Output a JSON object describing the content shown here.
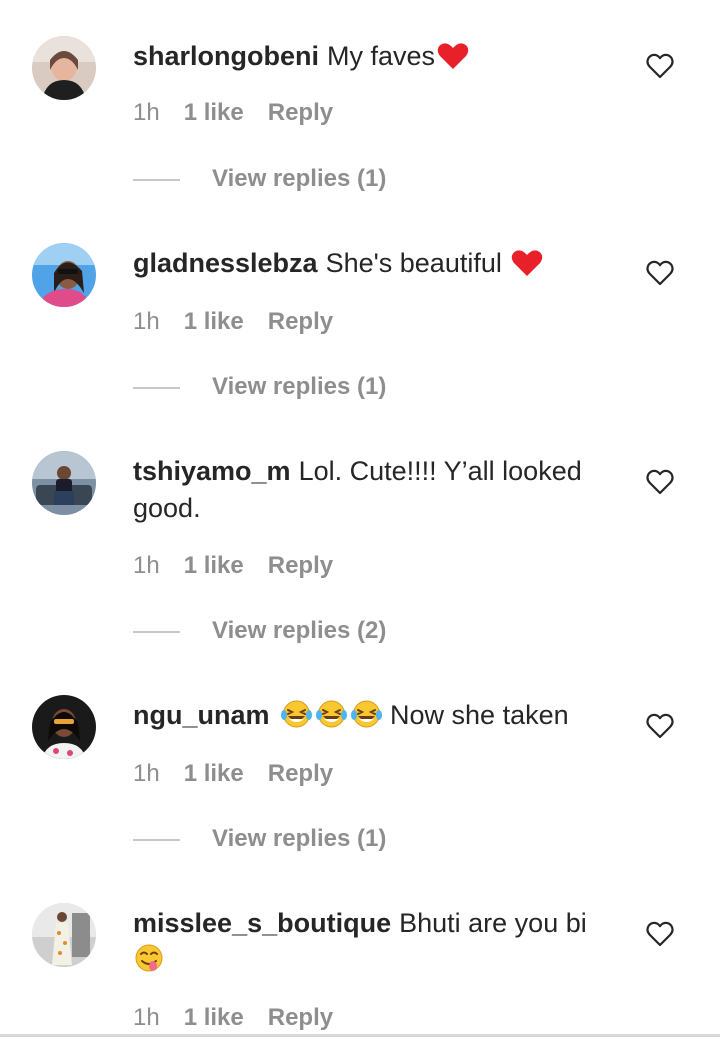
{
  "comments": [
    {
      "username": "sharlongobeni",
      "text": "My faves",
      "emoji": [
        "heart"
      ],
      "time": "1h",
      "likes": "1 like",
      "reply": "Reply",
      "view_replies": "View replies (1)"
    },
    {
      "username": "gladnesslebza",
      "text": "She's beautiful ",
      "emoji": [
        "heart"
      ],
      "time": "1h",
      "likes": "1 like",
      "reply": "Reply",
      "view_replies": "View replies (1)"
    },
    {
      "username": "tshiyamo_m",
      "text": "Lol. Cute!!!! Y’all looked good.",
      "emoji": [],
      "time": "1h",
      "likes": "1 like",
      "reply": "Reply",
      "view_replies": "View replies (2)"
    },
    {
      "username": "ngu_unam",
      "text": " Now she taken",
      "emoji": [
        "laughing-tears",
        "laughing-tears",
        "laughing-tears"
      ],
      "time": "1h",
      "likes": "1 like",
      "reply": "Reply",
      "view_replies": "View replies (1)"
    },
    {
      "username": "misslee_s_boutique",
      "text": "Bhuti are you bi ",
      "emoji": [
        "yum-face"
      ],
      "time": "1h",
      "likes": "1 like",
      "reply": "Reply",
      "view_replies": ""
    }
  ],
  "colors": {
    "text": "#262626",
    "meta": "#8e8e8e",
    "heart_emoji": "#e8202a",
    "laugh_face": "#f9c72f"
  }
}
